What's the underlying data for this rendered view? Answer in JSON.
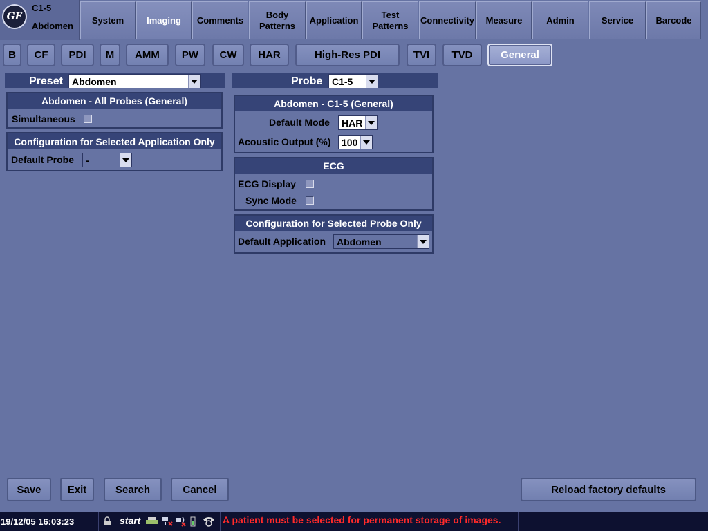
{
  "header": {
    "logo": "GE",
    "probe": "C1-5",
    "application": "Abdomen",
    "tabs": [
      {
        "label": "System"
      },
      {
        "label": "Imaging"
      },
      {
        "label": "Comments"
      },
      {
        "label": "Body Patterns"
      },
      {
        "label": "Application"
      },
      {
        "label": "Test Patterns"
      },
      {
        "label": "Connectivity"
      },
      {
        "label": "Measure"
      },
      {
        "label": "Admin"
      },
      {
        "label": "Service"
      },
      {
        "label": "Barcode"
      }
    ],
    "active_tab": "Imaging"
  },
  "subtabs": {
    "items": [
      "B",
      "CF",
      "PDI",
      "M",
      "AMM",
      "PW",
      "CW",
      "HAR",
      "High-Res PDI",
      "TVI",
      "TVD",
      "General"
    ],
    "active": "General"
  },
  "left": {
    "preset_label": "Preset",
    "preset_value": "Abdomen",
    "all_probes_title": "Abdomen - All Probes (General)",
    "simultaneous_label": "Simultaneous",
    "simultaneous_checked": false,
    "config_app_title": "Configuration for Selected Application Only",
    "default_probe_label": "Default Probe",
    "default_probe_value": "-"
  },
  "right": {
    "probe_label": "Probe",
    "probe_value": "C1-5",
    "general_title": "Abdomen - C1-5 (General)",
    "default_mode_label": "Default Mode",
    "default_mode_value": "HAR",
    "acoustic_label": "Acoustic Output (%)",
    "acoustic_value": "100",
    "ecg_title": "ECG",
    "ecg_display_label": "ECG Display",
    "ecg_display_checked": false,
    "sync_mode_label": "Sync Mode",
    "sync_mode_checked": false,
    "config_probe_title": "Configuration for Selected Probe Only",
    "default_app_label": "Default Application",
    "default_app_value": "Abdomen"
  },
  "buttons": {
    "save": "Save",
    "exit": "Exit",
    "search": "Search",
    "cancel": "Cancel",
    "reload": "Reload factory defaults"
  },
  "statusbar": {
    "datetime": "19/12/05 16:03:23",
    "start": "start",
    "message": "A patient must be selected for permanent storage of images.",
    "message_color": "#ff2a2a"
  }
}
